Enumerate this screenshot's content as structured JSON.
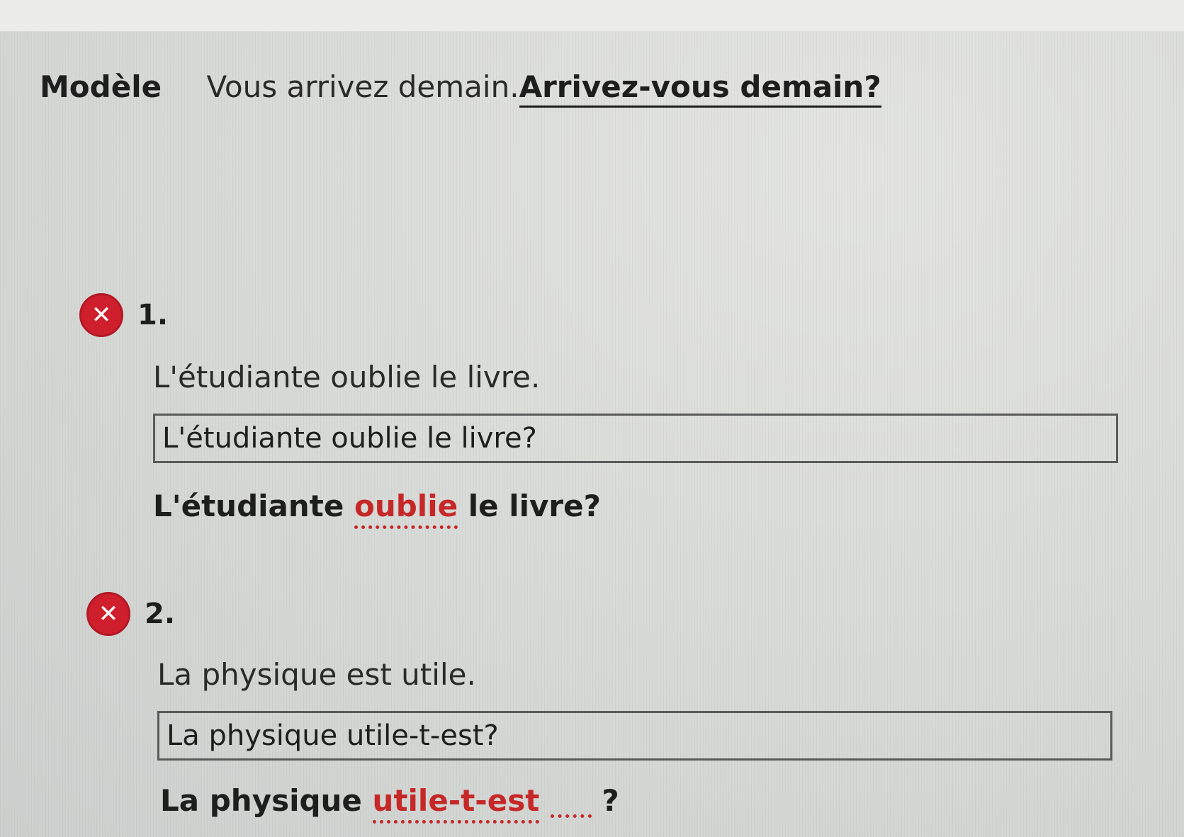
{
  "modele": {
    "label": "Modèle",
    "sentence": "Vous arrivez demain.",
    "answer": "Arrivez-vous demain?"
  },
  "items": [
    {
      "number": "1.",
      "status_icon": "x-circle-icon",
      "prompt": "L'étudiante oublie le livre.",
      "student_answer": "L'étudiante oublie le livre?",
      "correction": {
        "before": "L'étudiante ",
        "mistake": "oublie",
        "after": " le livre?"
      }
    },
    {
      "number": "2.",
      "status_icon": "x-circle-icon",
      "prompt": "La physique est utile.",
      "student_answer": "La physique utile-t-est?",
      "correction": {
        "before": "La physique ",
        "mistake": "utile-t-est",
        "after": "?"
      }
    }
  ],
  "colors": {
    "error_red": "#cf1f2c",
    "text": "#1e1e1e"
  }
}
